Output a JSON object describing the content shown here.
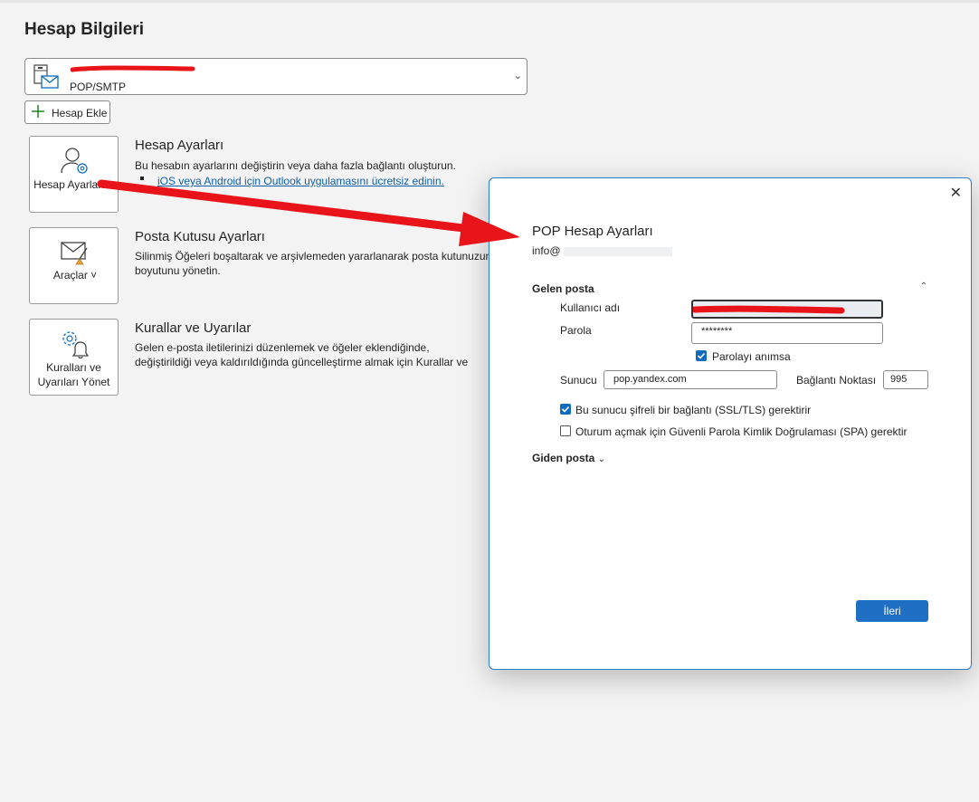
{
  "page": {
    "title": "Hesap Bilgileri",
    "account": {
      "type": "POP/SMTP"
    },
    "add_account_label": "Hesap Ekle"
  },
  "tiles": [
    {
      "label": "Hesap Ayarları ˅",
      "title": "Hesap Ayarları",
      "desc": "Bu hesabın ayarlarını değiştirin veya daha fazla bağlantı oluşturun.",
      "link": "iOS veya Android için Outlook uygulamasını ücretsiz edinin."
    },
    {
      "label": "Araçlar ˅",
      "title": "Posta Kutusu Ayarları",
      "desc": "Silinmiş Öğeleri boşaltarak ve arşivlemeden yararlanarak posta kutunuzun boyutunu yönetin."
    },
    {
      "label": "Kuralları ve Uyarıları Yönet",
      "title": "Kurallar ve Uyarılar",
      "desc": "Gelen e-posta iletilerinizi düzenlemek ve öğeler eklendiğinde, değiştirildiği veya kaldırıldığında güncelleştirme almak için Kurallar ve Uyarılar'ı kullanın."
    }
  ],
  "dialog": {
    "title": "POP Hesap Ayarları",
    "email_prefix": "info@",
    "incoming_title": "Gelen posta",
    "username_label": "Kullanıcı adı",
    "password_label": "Parola",
    "password_value": "********",
    "remember_password_label": "Parolayı anımsa",
    "server_label": "Sunucu",
    "server_value": "pop.yandex.com",
    "port_label": "Bağlantı Noktası",
    "port_value": "995",
    "ssl_label": "Bu sunucu şifreli bir bağlantı (SSL/TLS) gerektirir",
    "spa_label": "Oturum açmak için Güvenli Parola Kimlik Doğrulaması (SPA) gerektir",
    "outgoing_title": "Giden posta",
    "next_label": "İleri",
    "remember_checked": true,
    "ssl_checked": true,
    "spa_checked": false
  },
  "colors": {
    "accent": "#0f6cbd",
    "annotation": "#e8141a"
  },
  "icons": [
    "account-card-icon",
    "plus-icon",
    "person-gear-icon",
    "envelope-broom-icon",
    "gear-bell-icon",
    "close-icon",
    "chevron-down-icon",
    "chevron-up-icon",
    "checkmark-icon"
  ]
}
